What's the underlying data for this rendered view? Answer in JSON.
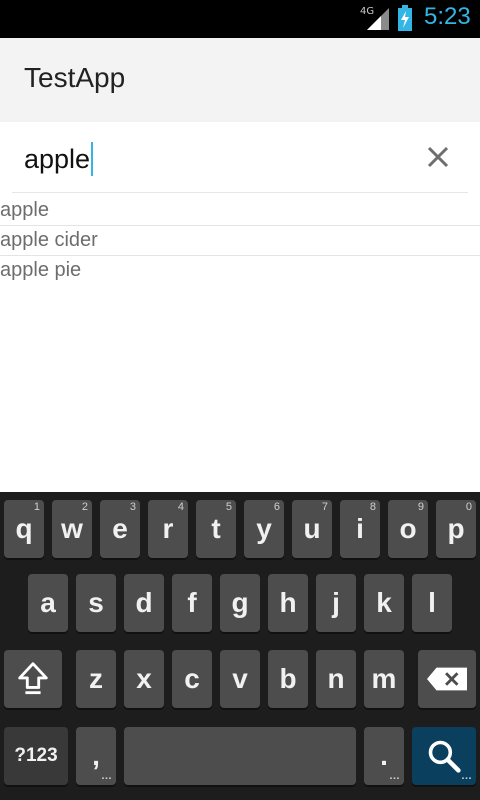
{
  "status_bar": {
    "network": "4G",
    "time": "5:23",
    "icons": [
      "signal-icon",
      "battery-charging-icon"
    ]
  },
  "action_bar": {
    "title": "TestApp"
  },
  "search": {
    "value": "apple",
    "clear_icon": "close-icon"
  },
  "suggestions": [
    {
      "label": "apple"
    },
    {
      "label": "apple cider"
    },
    {
      "label": "apple pie"
    }
  ],
  "keyboard": {
    "row1": [
      {
        "label": "q",
        "hint": "1"
      },
      {
        "label": "w",
        "hint": "2"
      },
      {
        "label": "e",
        "hint": "3"
      },
      {
        "label": "r",
        "hint": "4"
      },
      {
        "label": "t",
        "hint": "5"
      },
      {
        "label": "y",
        "hint": "6"
      },
      {
        "label": "u",
        "hint": "7"
      },
      {
        "label": "i",
        "hint": "8"
      },
      {
        "label": "o",
        "hint": "9"
      },
      {
        "label": "p",
        "hint": "0"
      }
    ],
    "row2": [
      "a",
      "s",
      "d",
      "f",
      "g",
      "h",
      "j",
      "k",
      "l"
    ],
    "row3": [
      "z",
      "x",
      "c",
      "v",
      "b",
      "n",
      "m"
    ],
    "symbols_label": "?123",
    "comma_label": ",",
    "period_label": ".",
    "shift_icon": "shift-icon",
    "delete_icon": "backspace-icon",
    "search_icon": "search-icon"
  },
  "colors": {
    "accent": "#33b5e5",
    "keyboard_bg": "#1d1d1d",
    "key": "#4d4d4d",
    "search_key": "#0b3f5e"
  }
}
